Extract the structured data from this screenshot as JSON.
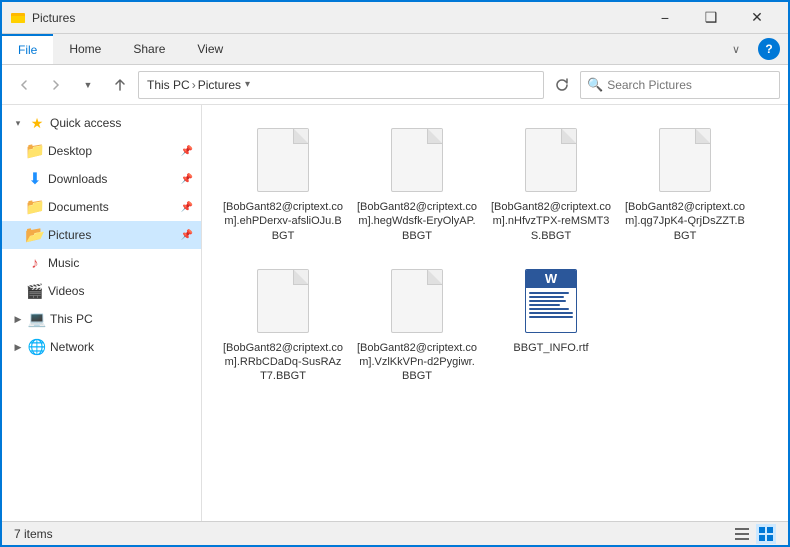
{
  "window": {
    "title": "Pictures",
    "icon": "folder-icon"
  },
  "titlebar": {
    "minimize": "−",
    "restore": "❑",
    "close": "✕"
  },
  "ribbon": {
    "tabs": [
      "File",
      "Home",
      "Share",
      "View"
    ],
    "active_tab": "File",
    "quick_access": [
      "back",
      "forward",
      "dropdown"
    ]
  },
  "address": {
    "back_disabled": true,
    "forward_disabled": true,
    "up": true,
    "path": [
      "This PC",
      "Pictures"
    ],
    "dropdown_arrow": "∨",
    "refresh": "↻",
    "search_placeholder": "Search Pictures"
  },
  "sidebar": {
    "sections": [
      {
        "id": "quick-access",
        "label": "Quick access",
        "expanded": true,
        "items": [
          {
            "id": "desktop",
            "label": "Desktop",
            "pinned": true,
            "icon": "folder"
          },
          {
            "id": "downloads",
            "label": "Downloads",
            "pinned": true,
            "icon": "download"
          },
          {
            "id": "documents",
            "label": "Documents",
            "pinned": true,
            "icon": "folder"
          },
          {
            "id": "pictures",
            "label": "Pictures",
            "pinned": true,
            "icon": "folder-open",
            "selected": true
          },
          {
            "id": "music",
            "label": "Music",
            "icon": "music"
          },
          {
            "id": "videos",
            "label": "Videos",
            "icon": "video"
          }
        ]
      },
      {
        "id": "this-pc",
        "label": "This PC",
        "expanded": false,
        "icon": "computer"
      },
      {
        "id": "network",
        "label": "Network",
        "expanded": false,
        "icon": "network"
      }
    ]
  },
  "files": [
    {
      "id": "file1",
      "name": "[BobGant82@criptext.com].ehPDerxv-afsliOJu.BBGT",
      "type": "generic"
    },
    {
      "id": "file2",
      "name": "[BobGant82@criptext.com].hegWdsfk-EryOlyAP.BBGT",
      "type": "generic"
    },
    {
      "id": "file3",
      "name": "[BobGant82@criptext.com].nHfvzTPX-reMSMT3S.BBGT",
      "type": "generic"
    },
    {
      "id": "file4",
      "name": "[BobGant82@criptext.com].qg7JpK4-QrjDsZZT.BBGT",
      "type": "generic"
    },
    {
      "id": "file5",
      "name": "[BobGant82@criptext.com].RRbCDaDq-SusRAzT7.BBGT",
      "type": "generic"
    },
    {
      "id": "file6",
      "name": "[BobGant82@criptext.com].VzlKkVPn-d2Pygiwr.BBGT",
      "type": "generic"
    },
    {
      "id": "file7",
      "name": "BBGT_INFO.rtf",
      "type": "word"
    }
  ],
  "status": {
    "item_count": "7 items"
  }
}
